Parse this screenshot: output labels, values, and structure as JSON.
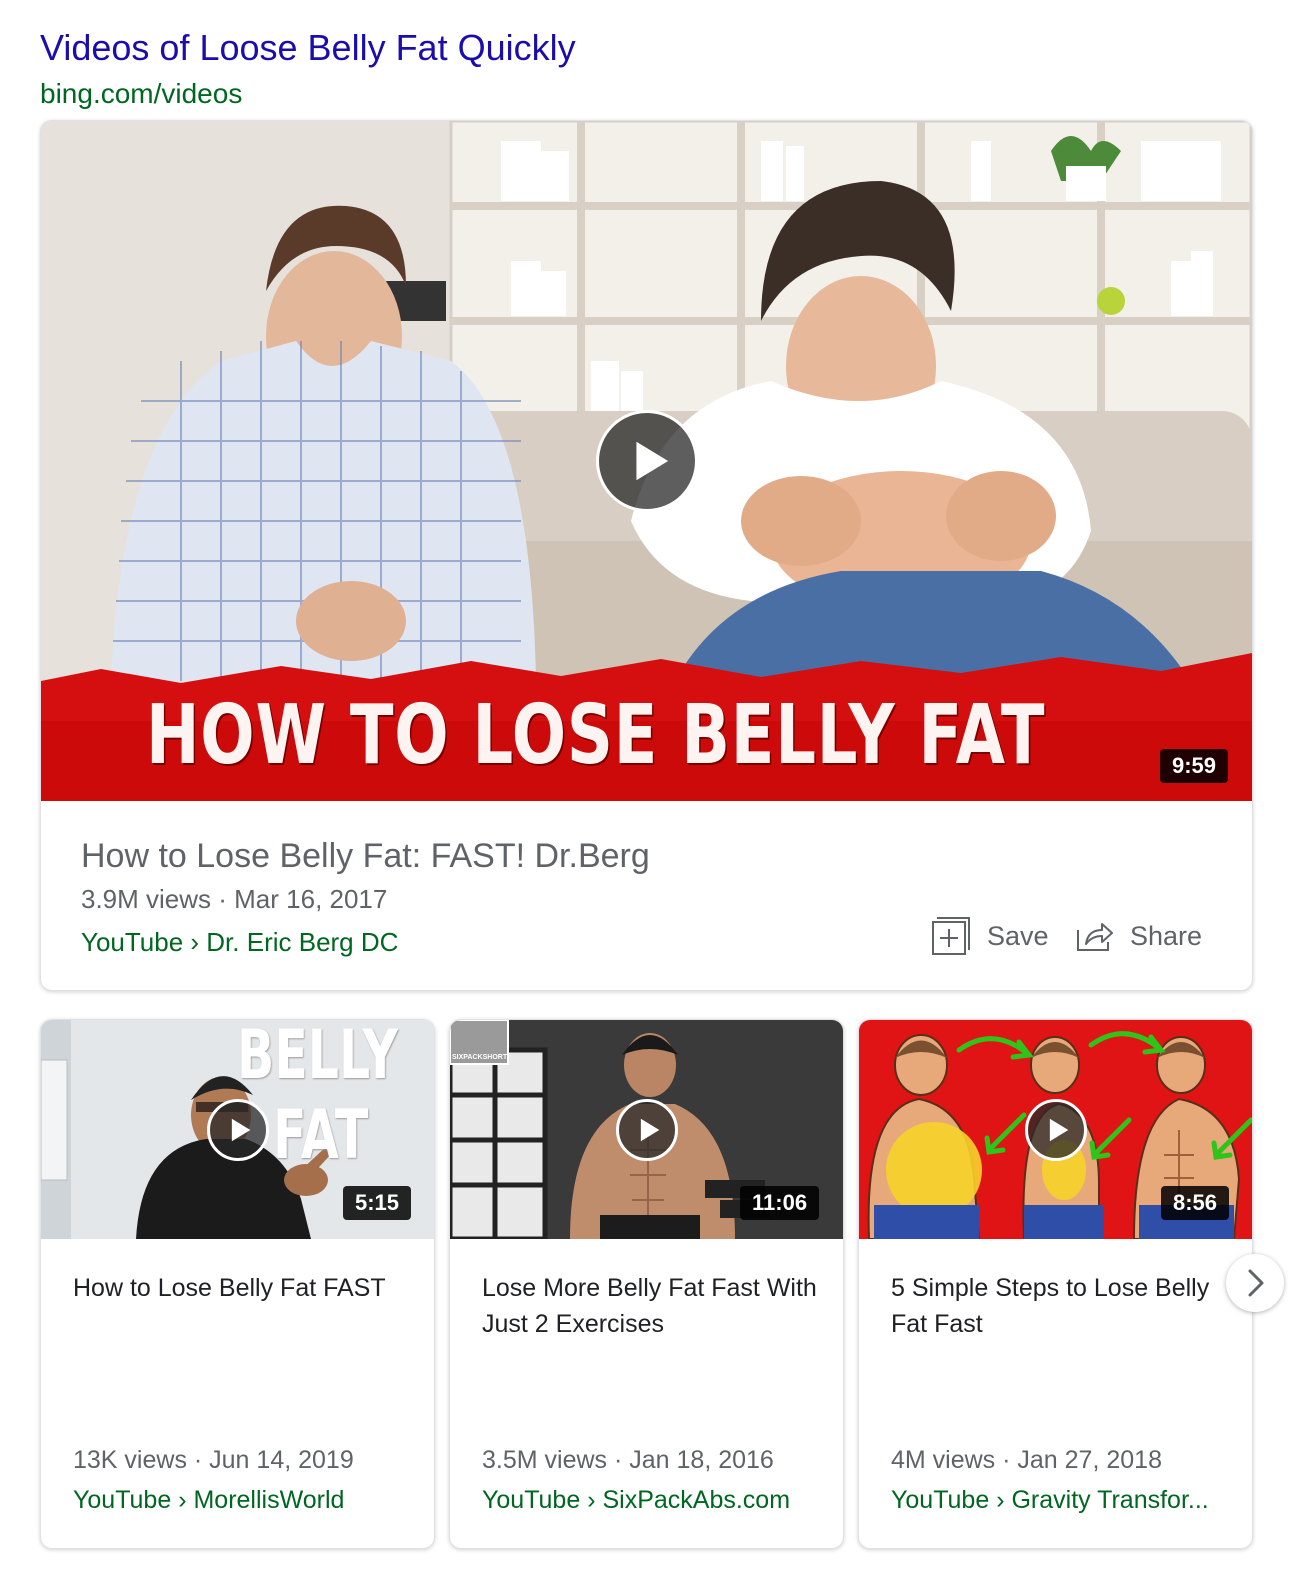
{
  "header": {
    "title": "Videos of Loose Belly Fat Quickly",
    "url": "bing.com/videos"
  },
  "main_video": {
    "thumbnail_banner": "HOW TO LOSE BELLY FAT",
    "duration": "9:59",
    "title": "How to Lose Belly Fat: FAST! Dr.Berg",
    "meta": "3.9M views · Mar 16, 2017",
    "source": "YouTube › Dr. Eric Berg DC",
    "save_label": "Save",
    "share_label": "Share"
  },
  "videos": [
    {
      "thumb_text_1": "BELLY",
      "thumb_text_2": "FAT",
      "duration": "5:15",
      "title": "How to Lose Belly Fat FAST",
      "meta": "13K views · Jun 14, 2019",
      "source": "YouTube › MorellisWorld"
    },
    {
      "thumb_logo": "SIXPACKSHORTCUTS.COM",
      "duration": "11:06",
      "title": "Lose More Belly Fat Fast With Just 2 Exercises",
      "meta": "3.5M views · Jan 18, 2016",
      "source": "YouTube › SixPackAbs.com"
    },
    {
      "duration": "8:56",
      "title": "5 Simple Steps to Lose Belly Fat Fast",
      "meta": "4M views · Jan 27, 2018",
      "source": "YouTube › Gravity Transfor..."
    }
  ],
  "colors": {
    "title_link": "#1a0dab",
    "url_green": "#006621",
    "banner_red": "#d50f0f"
  },
  "icons": [
    "play-icon",
    "save-icon",
    "share-icon",
    "chevron-right-icon"
  ]
}
